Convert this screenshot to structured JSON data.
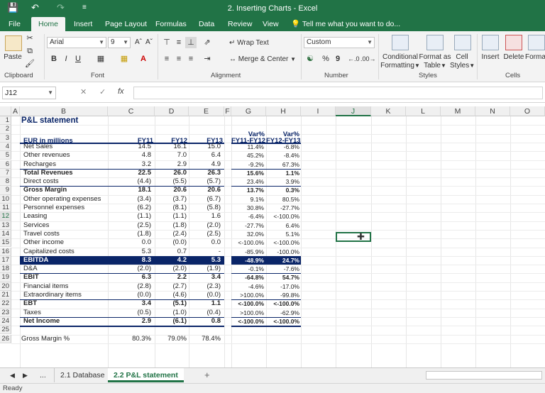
{
  "window": {
    "title": "2. Inserting Charts - Excel"
  },
  "qa": {
    "save": "💾",
    "undo": "↶",
    "redo": "↷",
    "more": "≡"
  },
  "tabs": [
    "File",
    "Home",
    "Insert",
    "Page Layout",
    "Formulas",
    "Data",
    "Review",
    "View"
  ],
  "tellme": "Tell me what you want to do...",
  "ribbon": {
    "paste": "Paste",
    "font_name": "Arial",
    "font_size": "9",
    "wrap_text": "Wrap Text",
    "merge_center": "Merge & Center",
    "number_format": "Custom",
    "conditional": "Conditional",
    "formatting": "Formatting",
    "format_as": "Format as",
    "table": "Table",
    "cell": "Cell",
    "styles_btn": "Styles",
    "insert": "Insert",
    "delete": "Delete",
    "format": "Forma",
    "groups": [
      "Clipboard",
      "Font",
      "Alignment",
      "Number",
      "Styles",
      "Cells"
    ],
    "bold": "B",
    "italic": "I",
    "underline": "U",
    "pct": "%",
    "comma": "9"
  },
  "formula_bar": {
    "name_box": "J12",
    "fx": "fx",
    "value": ""
  },
  "columns": [
    "A",
    "B",
    "C",
    "D",
    "E",
    "F",
    "G",
    "H",
    "I",
    "J",
    "K",
    "L",
    "M",
    "N",
    "O"
  ],
  "rows": [
    "1",
    "2",
    "3",
    "4",
    "5",
    "6",
    "7",
    "8",
    "9",
    "10",
    "11",
    "12",
    "13",
    "14",
    "15",
    "16",
    "17",
    "18",
    "19",
    "20",
    "21",
    "22",
    "23",
    "24",
    "25",
    "26"
  ],
  "sheet": {
    "title": "P&L statement",
    "header": {
      "label": "EUR in millions",
      "fy11": "FY11",
      "fy12": "FY12",
      "fy13": "FY13",
      "var_top1": "Var%",
      "var_top2": "Var%",
      "var1": "FY11-FY12",
      "var2": "FY12-FY13"
    },
    "lines": [
      {
        "label": "Net Sales",
        "fy11": "14.5",
        "fy12": "16.1",
        "fy13": "15.0",
        "v1": "11.4%",
        "v2": "-6.8%"
      },
      {
        "label": "Other revenues",
        "fy11": "4.8",
        "fy12": "7.0",
        "fy13": "6.4",
        "v1": "45.2%",
        "v2": "-8.4%"
      },
      {
        "label": "Recharges",
        "fy11": "3.2",
        "fy12": "2.9",
        "fy13": "4.9",
        "v1": "-9.2%",
        "v2": "67.3%"
      },
      {
        "label": "Total Revenues",
        "fy11": "22.5",
        "fy12": "26.0",
        "fy13": "26.3",
        "v1": "15.6%",
        "v2": "1.1%"
      },
      {
        "label": "Direct costs",
        "fy11": "(4.4)",
        "fy12": "(5.5)",
        "fy13": "(5.7)",
        "v1": "23.4%",
        "v2": "3.9%"
      },
      {
        "label": "Gross Margin",
        "fy11": "18.1",
        "fy12": "20.6",
        "fy13": "20.6",
        "v1": "13.7%",
        "v2": "0.3%"
      },
      {
        "label": "Other operating expenses",
        "fy11": "(3.4)",
        "fy12": "(3.7)",
        "fy13": "(6.7)",
        "v1": "9.1%",
        "v2": "80.5%"
      },
      {
        "label": "Personnel expenses",
        "fy11": "(6.2)",
        "fy12": "(8.1)",
        "fy13": "(5.8)",
        "v1": "30.8%",
        "v2": "-27.7%"
      },
      {
        "label": "Leasing",
        "fy11": "(1.1)",
        "fy12": "(1.1)",
        "fy13": "1.6",
        "v1": "-6.4%",
        "v2": "<-100.0%"
      },
      {
        "label": "Services",
        "fy11": "(2.5)",
        "fy12": "(1.8)",
        "fy13": "(2.0)",
        "v1": "-27.7%",
        "v2": "6.4%"
      },
      {
        "label": "Travel costs",
        "fy11": "(1.8)",
        "fy12": "(2.4)",
        "fy13": "(2.5)",
        "v1": "32.0%",
        "v2": "5.1%"
      },
      {
        "label": "Other income",
        "fy11": "0.0",
        "fy12": "(0.0)",
        "fy13": "0.0",
        "v1": "<-100.0%",
        "v2": "<-100.0%"
      },
      {
        "label": "Capitalized costs",
        "fy11": "5.3",
        "fy12": "0.7",
        "fy13": "-",
        "v1": "-85.9%",
        "v2": "-100.0%"
      },
      {
        "label": "EBITDA",
        "fy11": "8.3",
        "fy12": "4.2",
        "fy13": "5.3",
        "v1": "-48.9%",
        "v2": "24.7%"
      },
      {
        "label": "D&A",
        "fy11": "(2.0)",
        "fy12": "(2.0)",
        "fy13": "(1.9)",
        "v1": "-0.1%",
        "v2": "-7.6%"
      },
      {
        "label": "EBIT",
        "fy11": "6.3",
        "fy12": "2.2",
        "fy13": "3.4",
        "v1": "-64.8%",
        "v2": "54.7%"
      },
      {
        "label": "Financial items",
        "fy11": "(2.8)",
        "fy12": "(2.7)",
        "fy13": "(2.3)",
        "v1": "-4.6%",
        "v2": "-17.0%"
      },
      {
        "label": "Extraordinary items",
        "fy11": "(0.0)",
        "fy12": "(4.6)",
        "fy13": "(0.0)",
        "v1": ">100.0%",
        "v2": "-99.8%"
      },
      {
        "label": "EBT",
        "fy11": "3.4",
        "fy12": "(5.1)",
        "fy13": "1.1",
        "v1": "<-100.0%",
        "v2": "<-100.0%"
      },
      {
        "label": "Taxes",
        "fy11": "(0.5)",
        "fy12": "(1.0)",
        "fy13": "(0.4)",
        "v1": ">100.0%",
        "v2": "-62.9%"
      },
      {
        "label": "Net Income",
        "fy11": "2.9",
        "fy12": "(6.1)",
        "fy13": "0.8",
        "v1": "<-100.0%",
        "v2": "<-100.0%"
      }
    ],
    "gross_margin_pct": {
      "label": "Gross Margin %",
      "fy11": "80.3%",
      "fy12": "79.0%",
      "fy13": "78.4%"
    }
  },
  "sheet_tabs": {
    "more": "...",
    "tab1": "2.1 Database",
    "tab2": "2.2 P&L statement",
    "add": "+"
  },
  "status": "Ready"
}
